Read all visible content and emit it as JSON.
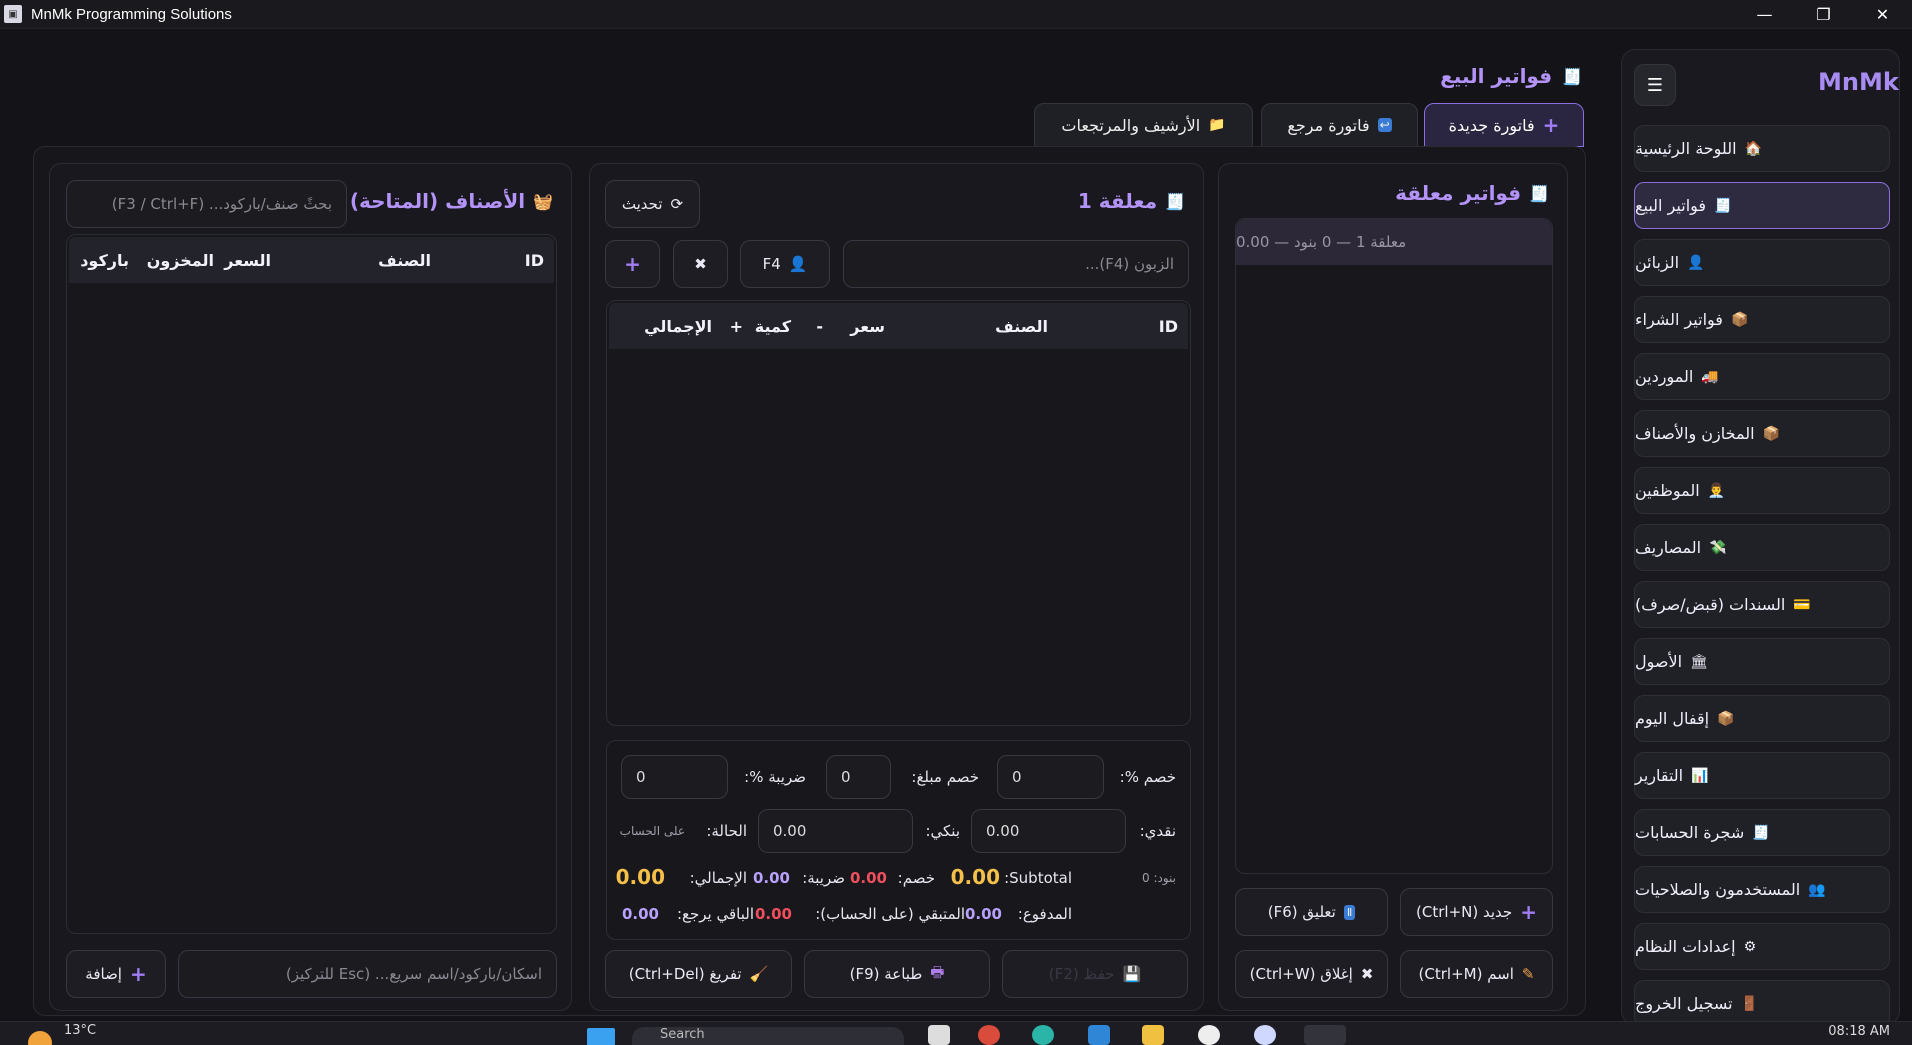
{
  "window": {
    "title": "MnMk Programming Solutions",
    "minimize": "—",
    "restore": "❐",
    "close": "✕"
  },
  "sidebar": {
    "brand": "MnMk",
    "menu_glyph": "☰",
    "items": [
      {
        "label": "اللوحة الرئيسية",
        "icon": "🏠"
      },
      {
        "label": "فواتير البيع",
        "icon": "🧾"
      },
      {
        "label": "الزبائن",
        "icon": "👤"
      },
      {
        "label": "فواتير الشراء",
        "icon": "📦"
      },
      {
        "label": "الموردين",
        "icon": "🚚"
      },
      {
        "label": "المخازن والأصناف",
        "icon": "📦"
      },
      {
        "label": "الموظفين",
        "icon": "👨‍💼"
      },
      {
        "label": "المصاريف",
        "icon": "💸"
      },
      {
        "label": "السندات (قبض/صرف)",
        "icon": "💳"
      },
      {
        "label": "الأصول",
        "icon": "🏛"
      },
      {
        "label": "إقفال اليوم",
        "icon": "📦"
      },
      {
        "label": "التقارير",
        "icon": "📊"
      },
      {
        "label": "شجرة الحسابات",
        "icon": "🧾"
      },
      {
        "label": "المستخدمون والصلاحيات",
        "icon": "👥"
      },
      {
        "label": "إعدادات النظام",
        "icon": "⚙"
      },
      {
        "label": "تسجيل الخروج",
        "icon": "🚪"
      }
    ]
  },
  "page": {
    "title": "فواتير البيع",
    "title_icon": "🧾"
  },
  "tabs": [
    {
      "label": "فاتورة جديدة",
      "icon": "+"
    },
    {
      "label": "فاتورة مرجع",
      "icon": "↩"
    },
    {
      "label": "الأرشيف والمرتجعات",
      "icon": "📁"
    }
  ],
  "pending": {
    "title": "فواتير معلقة",
    "title_icon": "🧾",
    "selected_item": "معلقة 1 — 0 بنود — 0.00",
    "new_btn": "جديد (Ctrl+N)",
    "hold_btn": "تعليق (F6)",
    "rename_btn": "اسم (Ctrl+M)",
    "close_btn": "إغلاق (Ctrl+W)"
  },
  "invoice": {
    "title": "معلقة 1",
    "title_icon": "🧾",
    "refresh_btn": "تحديث",
    "refresh_icon": "⟳",
    "customer_placeholder": "الزبون (F4)...",
    "customer_btn": "F4",
    "clear_btn": "✖",
    "add_btn": "+",
    "columns": [
      "ID",
      "الصنف",
      "سعر",
      "-",
      "كمية",
      "+",
      "الإجمالي"
    ],
    "discount_pct_label": "خصم %:",
    "discount_pct_value": "0",
    "discount_amt_label": "خصم مبلغ:",
    "discount_amt_value": "0",
    "tax_pct_label": "ضريبة %:",
    "tax_pct_value": "0",
    "cash_label": "نقدي:",
    "cash_value": "0.00",
    "bank_label": "بنكي:",
    "bank_value": "0.00",
    "status_label": "الحالة:",
    "status_value": "على الحساب",
    "items_count": "بنود: 0",
    "subtotal_label": "Subtotal:",
    "subtotal_value": "0.00",
    "discount_label": "خصم:",
    "discount_value": "0.00",
    "tax_label": "ضريبة:",
    "tax_value": "0.00",
    "total_label": "الإجمالي:",
    "total_value": "0.00",
    "paid_label": "المدفوع:",
    "paid_value": "0.00",
    "remaining_label": "المتبقي (على الحساب):",
    "remaining_value": "0.00",
    "change_label": "الباقي يرجع:",
    "change_value": "0.00",
    "save_btn": "حفظ (F2)",
    "print_btn": "طباعة (F9)",
    "empty_btn": "تفريغ (Ctrl+Del)"
  },
  "products": {
    "title": "الأصناف (المتاحة)",
    "title_icon": "🧺",
    "search_placeholder": "بحثً صنف/باركود... (F3 / Ctrl+F)",
    "columns": [
      "ID",
      "الصنف",
      "السعر",
      "المخزون",
      "باركود"
    ],
    "scan_placeholder": "اسكان/باركود/اسم سريع... (Esc للتركيز)",
    "add_btn": "إضافة"
  },
  "taskbar": {
    "weather": "13°C",
    "search": "Search",
    "clock": "08:18 AM"
  },
  "colors": {
    "accent": "#b493f8",
    "red": "#ef4f5c",
    "gold": "#f4c04a"
  }
}
